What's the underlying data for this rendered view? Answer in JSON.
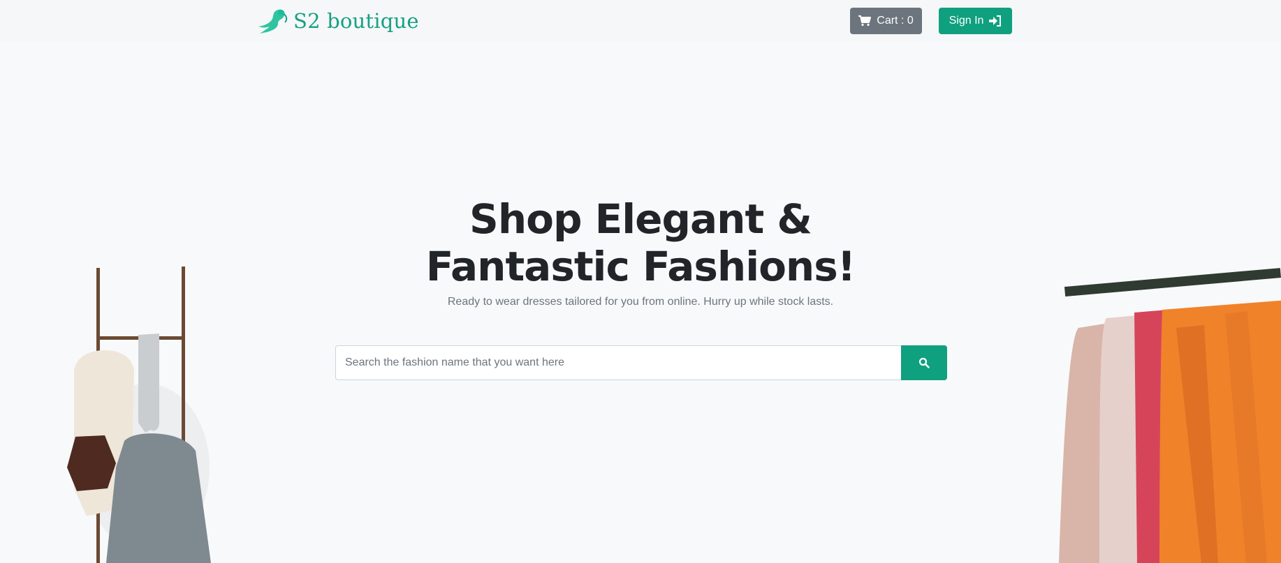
{
  "brand": {
    "name": "S2 boutique",
    "icon": "mermaid-logo-icon",
    "color": "#16a085"
  },
  "nav": {
    "cart_label": "Cart : 0",
    "cart_icon": "shopping-cart-icon",
    "signin_label": "Sign In",
    "signin_icon": "sign-in-icon"
  },
  "hero": {
    "title": "Shop Elegant & Fantastic Fashions!",
    "subtitle": "Ready to wear dresses tailored for you from online. Hurry up while stock lasts."
  },
  "search": {
    "placeholder": "Search the fashion name that you want here",
    "value": "",
    "button_icon": "search-icon"
  },
  "colors": {
    "accent": "#0fa07f",
    "secondary": "#6c757d",
    "background": "#f8f9fa"
  },
  "images": {
    "left": "clothes-ladder-rack-image",
    "right": "clothing-rail-image"
  }
}
